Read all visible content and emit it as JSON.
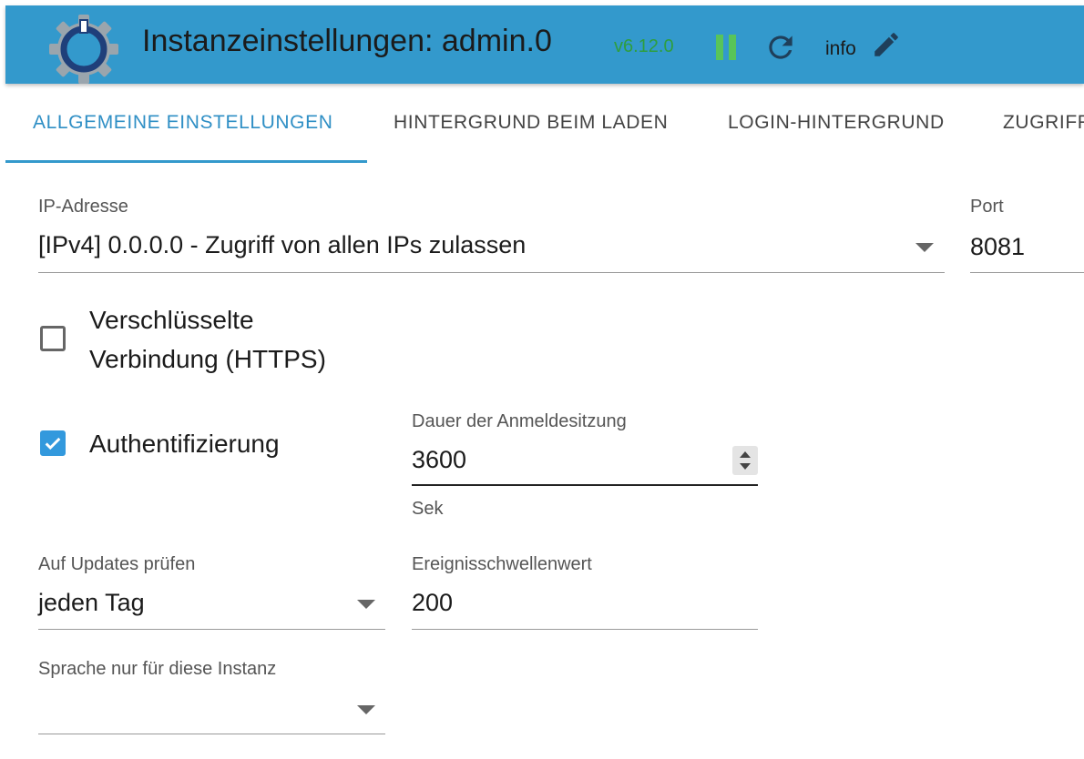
{
  "header": {
    "title": "Instanzeinstellungen: admin.0",
    "version": "v6.12.0",
    "info_label": "info",
    "icons": [
      "gear-logo-icon",
      "pause-icon",
      "reload-icon",
      "edit-icon"
    ],
    "colors": {
      "background": "#3399cc",
      "version": "#2e9e3e",
      "pause": "#58c45a"
    }
  },
  "tabs": [
    {
      "label": "ALLGEMEINE EINSTELLUNGEN",
      "active": true
    },
    {
      "label": "HINTERGRUND BEIM LADEN",
      "active": false
    },
    {
      "label": "LOGIN-HINTERGRUND",
      "active": false
    },
    {
      "label": "ZUGRIFF",
      "active": false
    }
  ],
  "form": {
    "ip": {
      "label": "IP-Adresse",
      "value": "[IPv4] 0.0.0.0 - Zugriff von allen IPs zulassen"
    },
    "port": {
      "label": "Port",
      "value": "8081"
    },
    "https": {
      "label_line1": "Verschlüsselte",
      "label_line2": "Verbindung (HTTPS)",
      "checked": false
    },
    "auth": {
      "label": "Authentifizierung",
      "checked": true
    },
    "session": {
      "label": "Dauer der Anmeldesitzung",
      "value": "3600",
      "helper": "Sek"
    },
    "updates": {
      "label": "Auf Updates prüfen",
      "value": "jeden Tag"
    },
    "threshold": {
      "label": "Ereignisschwellenwert",
      "value": "200"
    },
    "language": {
      "label": "Sprache nur für diese Instanz",
      "value": ""
    }
  },
  "accent_color": "#3399dd"
}
